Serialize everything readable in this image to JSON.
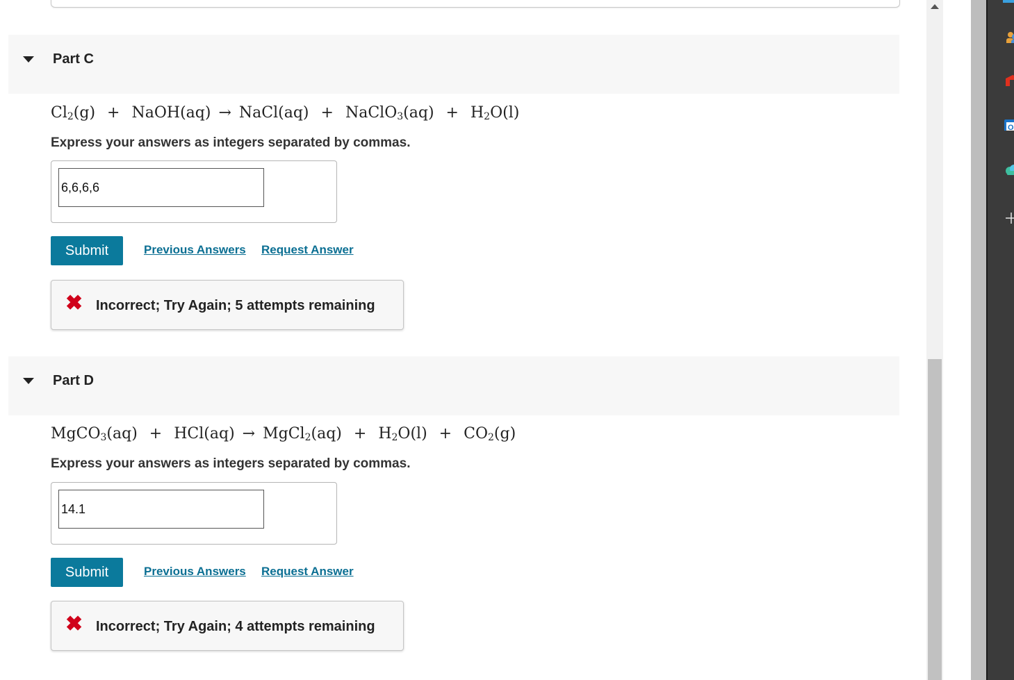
{
  "parts": [
    {
      "title": "Part C",
      "equation": {
        "lhs": [
          {
            "base": "Cl",
            "sub": "2",
            "state": "(g)"
          },
          {
            "base": "NaOH",
            "sub": "",
            "state": "(aq)"
          }
        ],
        "rhs": [
          {
            "base": "NaCl",
            "sub": "",
            "state": "(aq)"
          },
          {
            "base": "NaClO",
            "sub": "3",
            "state": "(aq)"
          },
          {
            "base": "H",
            "sub": "2",
            "base2": "O",
            "state": "(l)"
          }
        ]
      },
      "instruction": "Express your answers as integers separated by commas.",
      "answer_value": "6,6,6,6",
      "submit_label": "Submit",
      "previous_answers_label": "Previous Answers",
      "request_answer_label": "Request Answer",
      "feedback": "Incorrect; Try Again; 5 attempts remaining"
    },
    {
      "title": "Part D",
      "equation": {
        "lhs": [
          {
            "base": "MgCO",
            "sub": "3",
            "state": "(aq)"
          },
          {
            "base": "HCl",
            "sub": "",
            "state": "(aq)"
          }
        ],
        "rhs": [
          {
            "base": "MgCl",
            "sub": "2",
            "state": "(aq)"
          },
          {
            "base": "H",
            "sub": "2",
            "base2": "O",
            "state": "(l)"
          },
          {
            "base": "CO",
            "sub": "2",
            "state": "(g)"
          }
        ]
      },
      "instruction": "Express your answers as integers separated by commas.",
      "answer_value": "14.1",
      "submit_label": "Submit",
      "previous_answers_label": "Previous Answers",
      "request_answer_label": "Request Answer",
      "feedback": "Incorrect; Try Again; 4 attempts remaining"
    }
  ],
  "symbols": {
    "plus": "+",
    "arrow": "→",
    "incorrect_mark": "✖"
  },
  "colors": {
    "submit_bg": "#0b7a9c",
    "link": "#0b6f93",
    "error": "#d0021b",
    "header_bg": "#f7f7f7"
  },
  "icons": {
    "collapse": "caret-down-icon",
    "incorrect": "x-mark-icon",
    "dock": [
      "people-icon",
      "office-icon",
      "outlook-icon",
      "cloud-icon",
      "plus-icon"
    ]
  }
}
